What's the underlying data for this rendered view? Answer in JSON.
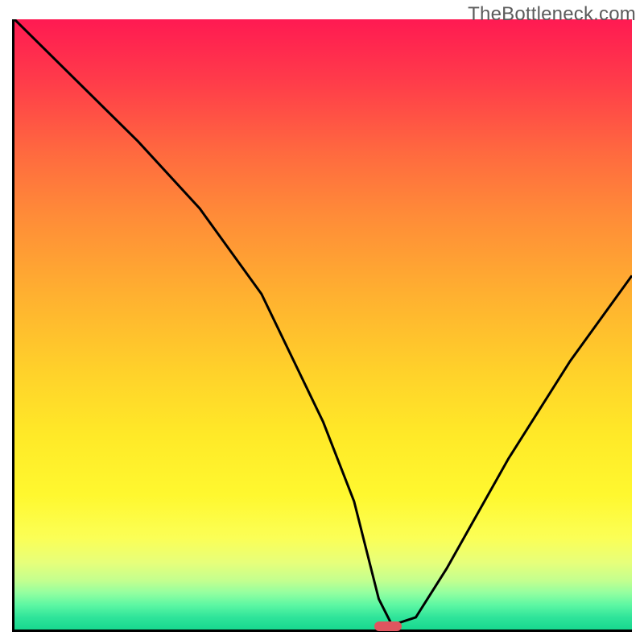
{
  "watermark": "TheBottleneck.com",
  "chart_data": {
    "type": "line",
    "title": "",
    "xlabel": "",
    "ylabel": "",
    "xlim": [
      0,
      100
    ],
    "ylim": [
      0,
      100
    ],
    "x": [
      0,
      10,
      20,
      30,
      40,
      50,
      55,
      59,
      61,
      62,
      65,
      70,
      80,
      90,
      100
    ],
    "values": [
      100,
      90,
      80,
      69,
      55,
      34,
      21,
      5,
      1,
      1,
      2,
      10,
      28,
      44,
      58
    ],
    "optimum_marker": {
      "x": 60.5,
      "y": 0.5,
      "width_pct": 4.5,
      "height_pct": 1.6
    },
    "gradient_stops": [
      {
        "pct": 0,
        "color": "#ff1a52"
      },
      {
        "pct": 50,
        "color": "#ffd22a"
      },
      {
        "pct": 85,
        "color": "#fbff56"
      },
      {
        "pct": 100,
        "color": "#18d88f"
      }
    ],
    "grid": false,
    "legend": null
  }
}
